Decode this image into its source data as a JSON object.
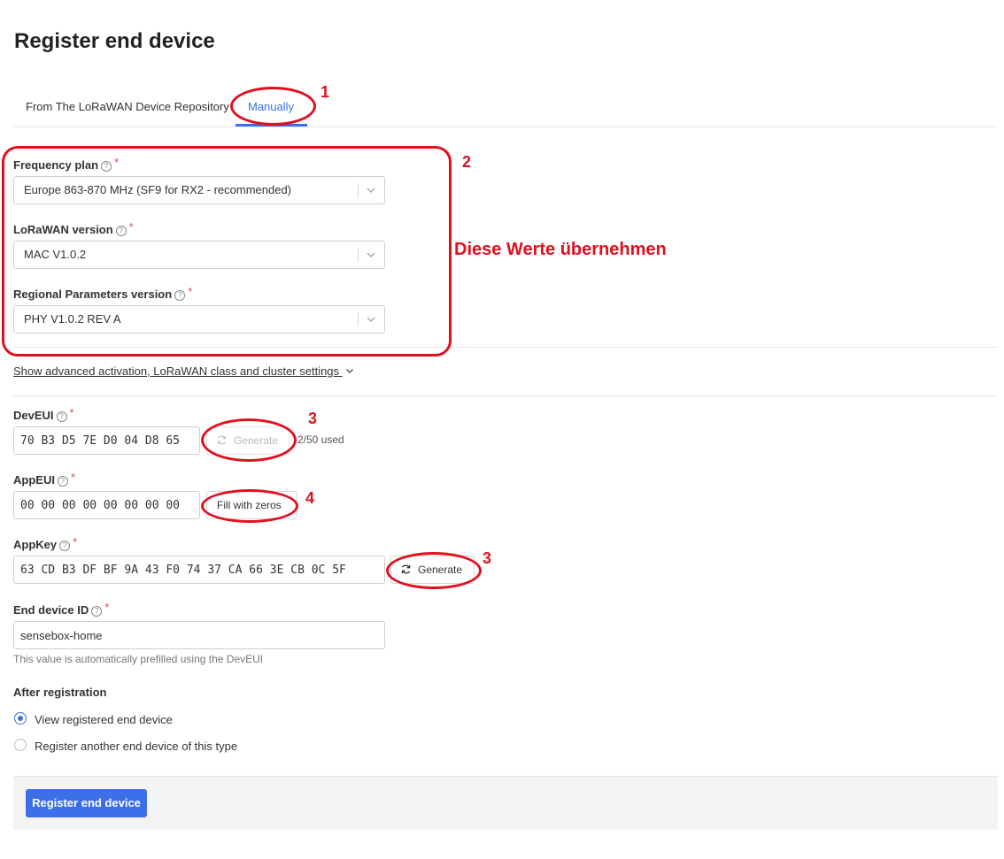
{
  "page_title": "Register end device",
  "tabs": [
    {
      "label": "From The LoRaWAN Device Repository",
      "active": false
    },
    {
      "label": "Manually",
      "active": true
    }
  ],
  "frequency_plan": {
    "label": "Frequency plan",
    "help": "?",
    "required": "*",
    "value": "Europe 863-870 MHz (SF9 for RX2 - recommended)"
  },
  "lorawan_version": {
    "label": "LoRaWAN version",
    "help": "?",
    "required": "*",
    "value": "MAC V1.0.2"
  },
  "regional_params": {
    "label": "Regional Parameters version",
    "help": "?",
    "required": "*",
    "value": "PHY V1.0.2 REV A"
  },
  "advanced_toggle": "Show advanced activation, LoRaWAN class and cluster settings",
  "deveui": {
    "label": "DevEUI",
    "help": "?",
    "required": "*",
    "value": "70 B3 D5 7E D0 04 D8 65",
    "button": "Generate",
    "usage": "2/50 used"
  },
  "appeui": {
    "label": "AppEUI",
    "help": "?",
    "required": "*",
    "value": "00 00 00 00 00 00 00 00",
    "button": "Fill with zeros"
  },
  "appkey": {
    "label": "AppKey",
    "help": "?",
    "required": "*",
    "value": "63 CD B3 DF BF 9A 43 F0 74 37 CA 66 3E CB 0C 5F",
    "button": "Generate"
  },
  "end_device_id": {
    "label": "End device ID",
    "help": "?",
    "required": "*",
    "value": "sensebox-home",
    "hint": "This value is automatically prefilled using the DevEUI"
  },
  "after_registration": {
    "label": "After registration",
    "options": [
      {
        "label": "View registered end device",
        "selected": true
      },
      {
        "label": "Register another end device of this type",
        "selected": false
      }
    ]
  },
  "submit_button": "Register end device",
  "annotations": {
    "n1": "1",
    "n2": "2",
    "n3a": "3",
    "n3b": "3",
    "n4": "4",
    "note": "Diese Werte übernehmen",
    "color": "#e0101e"
  },
  "colors": {
    "accent": "#3d6fe8",
    "required": "#e34a4a"
  }
}
